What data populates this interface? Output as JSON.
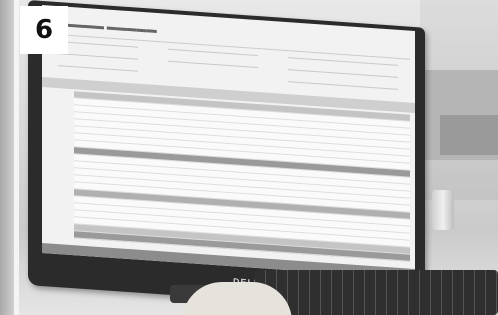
{
  "badge": {
    "number": "6"
  },
  "monitor": {
    "brand": "DELL"
  }
}
